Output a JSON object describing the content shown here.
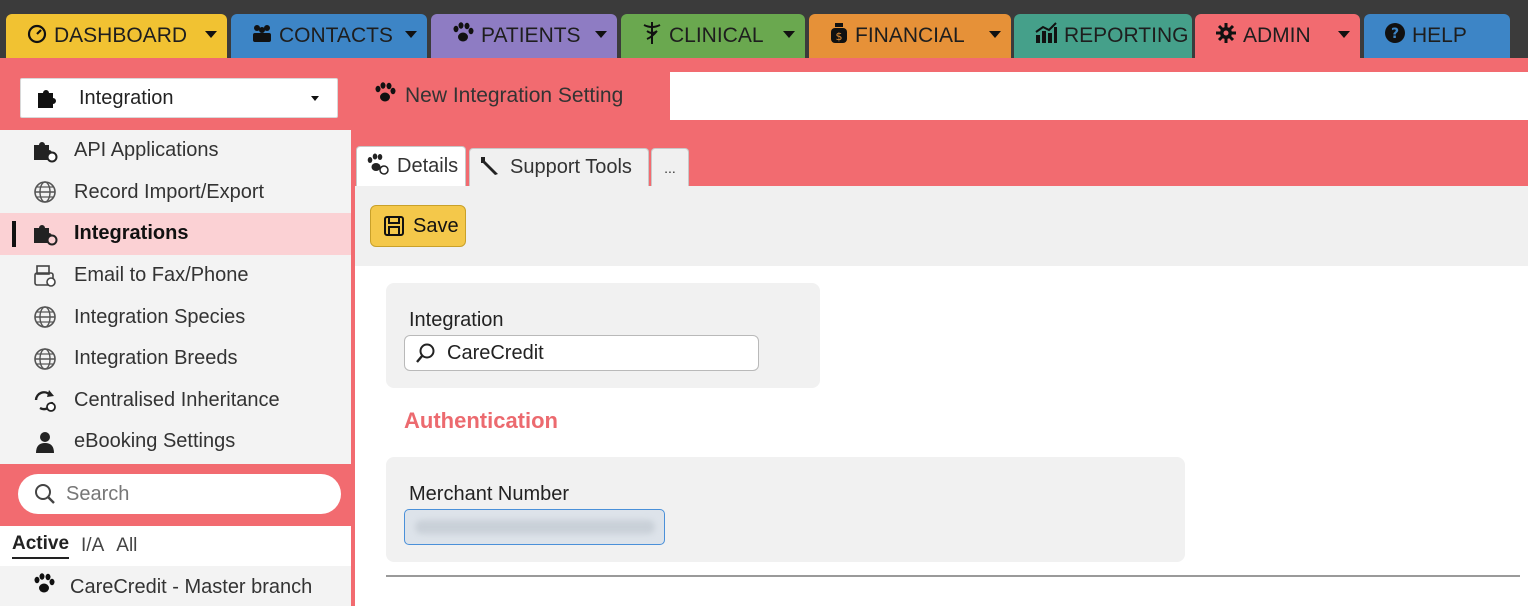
{
  "nav": {
    "tabs": [
      {
        "label": "DASHBOARD",
        "icon": "gauge-icon",
        "color": "#f1c232",
        "dropdown": true
      },
      {
        "label": "CONTACTS",
        "icon": "people-icon",
        "color": "#3d85c6",
        "dropdown": true
      },
      {
        "label": "PATIENTS",
        "icon": "paw-icon",
        "color": "#8e7cc3",
        "dropdown": true
      },
      {
        "label": "CLINICAL",
        "icon": "caduceus-icon",
        "color": "#6aa84f",
        "dropdown": true
      },
      {
        "label": "FINANCIAL",
        "icon": "money-bag-icon",
        "color": "#e69138",
        "dropdown": true
      },
      {
        "label": "REPORTING",
        "icon": "chart-icon",
        "color": "#45a08a",
        "dropdown": false
      },
      {
        "label": "ADMIN",
        "icon": "gear-icon",
        "color": "#f26b70",
        "dropdown": true
      },
      {
        "label": "HELP",
        "icon": "question-icon",
        "color": "#3d85c6",
        "dropdown": false
      }
    ]
  },
  "sidebar": {
    "module": "Integration",
    "items": [
      {
        "label": "API Applications",
        "icon": "puzzle-gear-icon",
        "active": false
      },
      {
        "label": "Record Import/Export",
        "icon": "globe-icon",
        "active": false
      },
      {
        "label": "Integrations",
        "icon": "puzzle-gear-icon",
        "active": true
      },
      {
        "label": "Email to Fax/Phone",
        "icon": "fax-icon",
        "active": false
      },
      {
        "label": "Integration Species",
        "icon": "globe-icon",
        "active": false
      },
      {
        "label": "Integration Breeds",
        "icon": "globe-icon",
        "active": false
      },
      {
        "label": "Centralised Inheritance",
        "icon": "sync-icon",
        "active": false
      },
      {
        "label": "eBooking Settings",
        "icon": "user-icon",
        "active": false
      }
    ],
    "search_placeholder": "Search",
    "filters": [
      "Active",
      "I/A",
      "All"
    ],
    "record": "CareCredit - Master branch"
  },
  "main": {
    "doc_tab": "New Integration Setting",
    "subtabs": [
      "Details",
      "Support Tools",
      "..."
    ],
    "save_label": "Save",
    "integration_label": "Integration",
    "integration_value": "CareCredit",
    "section_title": "Authentication",
    "merchant_label": "Merchant Number"
  },
  "colors": {
    "accent": "#f26b70",
    "topbar": "#3b3b3b",
    "save": "#f4c84a"
  }
}
